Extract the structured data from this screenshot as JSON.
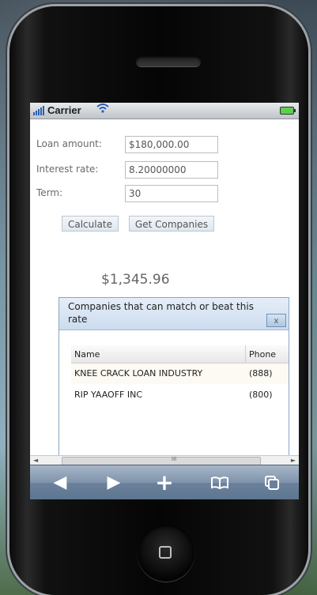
{
  "status_bar": {
    "carrier": "Carrier"
  },
  "form": {
    "loan_amount_label": "Loan amount:",
    "loan_amount_value": "$180,000.00",
    "interest_rate_label": "Interest rate:",
    "interest_rate_value": "8.20000000",
    "term_label": "Term:",
    "term_value": "30"
  },
  "buttons": {
    "calculate": "Calculate",
    "get_companies": "Get Companies"
  },
  "result": "$1,345.96",
  "dialog": {
    "title": "Companies that can match or beat this rate",
    "close_label": "x",
    "columns": [
      "Name",
      "Phone"
    ],
    "rows": [
      {
        "name": "KNEE CRACK LOAN INDUSTRY",
        "phone": "(888)"
      },
      {
        "name": "RIP YAAOFF INC",
        "phone": "(800)"
      }
    ]
  },
  "scrollbar": {
    "left_arrow": "◄",
    "right_arrow": "►",
    "grip": "III"
  },
  "toolbar": {
    "back_icon": "◀",
    "forward_icon": "▶",
    "add_icon": "+",
    "bookmarks_icon": "bookmarks",
    "pages_icon": "pages"
  }
}
